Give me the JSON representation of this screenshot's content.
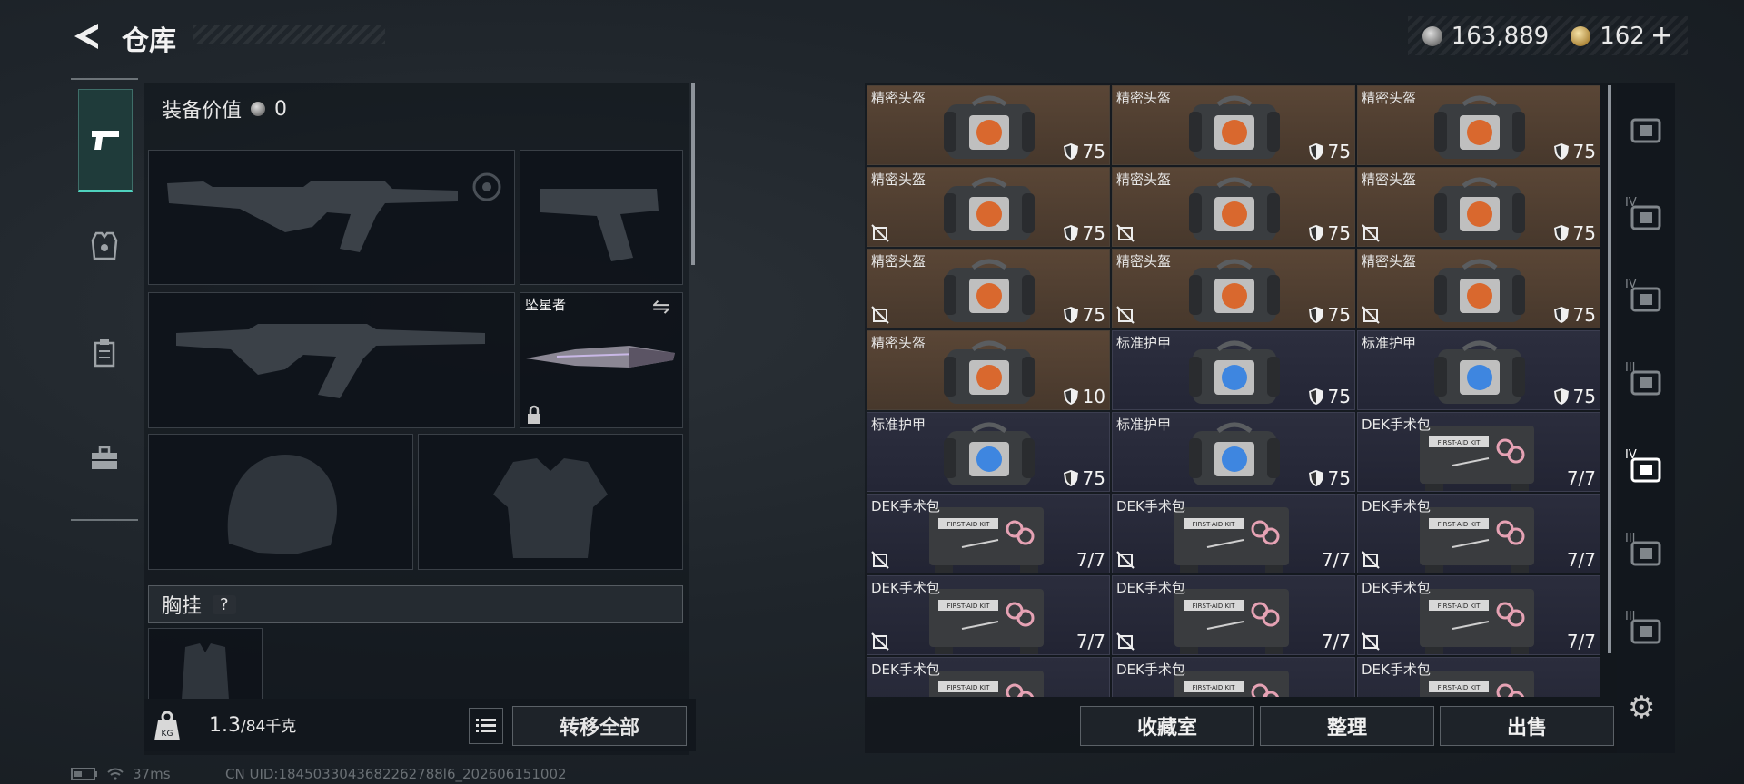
{
  "header": {
    "title": "仓库"
  },
  "currency": [
    {
      "amount": "163,889",
      "icon": "silver-coin-icon"
    },
    {
      "amount": "162",
      "icon": "gold-coin-icon",
      "plus": "+"
    }
  ],
  "loadout": {
    "equip_value_label": "装备价值",
    "equip_value": "0",
    "melee_name": "坠星者",
    "chest_label": "胸挂",
    "chest_help": "?"
  },
  "weight": {
    "current": "1.3",
    "max": "/84",
    "unit": "千克"
  },
  "buttons": {
    "transfer_all": "转移全部",
    "collection": "收藏室",
    "organize": "整理",
    "sell": "出售"
  },
  "status": {
    "ping": "37ms",
    "uid": "CN UID:1845033043682262788l6_202606151002"
  },
  "inventory": [
    {
      "name": "精密头盔",
      "type": "helm",
      "value": "75",
      "noins": false
    },
    {
      "name": "精密头盔",
      "type": "helm",
      "value": "75",
      "noins": false
    },
    {
      "name": "精密头盔",
      "type": "helm",
      "value": "75",
      "noins": false
    },
    {
      "name": "精密头盔",
      "type": "helm",
      "value": "75",
      "noins": true
    },
    {
      "name": "精密头盔",
      "type": "helm",
      "value": "75",
      "noins": true
    },
    {
      "name": "精密头盔",
      "type": "helm",
      "value": "75",
      "noins": true
    },
    {
      "name": "精密头盔",
      "type": "helm",
      "value": "75",
      "noins": true
    },
    {
      "name": "精密头盔",
      "type": "helm",
      "value": "75",
      "noins": true
    },
    {
      "name": "精密头盔",
      "type": "helm",
      "value": "75",
      "noins": true
    },
    {
      "name": "精密头盔",
      "type": "helm",
      "value": "10",
      "noins": false
    },
    {
      "name": "标准护甲",
      "type": "armor",
      "value": "75",
      "noins": false
    },
    {
      "name": "标准护甲",
      "type": "armor",
      "value": "75",
      "noins": false
    },
    {
      "name": "标准护甲",
      "type": "armor",
      "value": "75",
      "noins": false
    },
    {
      "name": "标准护甲",
      "type": "armor",
      "value": "75",
      "noins": false
    },
    {
      "name": "DEK手术包",
      "type": "med",
      "value": "7/7",
      "noins": false
    },
    {
      "name": "DEK手术包",
      "type": "med",
      "value": "7/7",
      "noins": true
    },
    {
      "name": "DEK手术包",
      "type": "med",
      "value": "7/7",
      "noins": true
    },
    {
      "name": "DEK手术包",
      "type": "med",
      "value": "7/7",
      "noins": true
    },
    {
      "name": "DEK手术包",
      "type": "med",
      "value": "7/7",
      "noins": true
    },
    {
      "name": "DEK手术包",
      "type": "med",
      "value": "7/7",
      "noins": true
    },
    {
      "name": "DEK手术包",
      "type": "med",
      "value": "7/7",
      "noins": true
    },
    {
      "name": "DEK手术包",
      "type": "med",
      "value": "",
      "noins": false
    },
    {
      "name": "DEK手术包",
      "type": "med",
      "value": "",
      "noins": false
    },
    {
      "name": "DEK手术包",
      "type": "med",
      "value": "",
      "noins": false
    }
  ],
  "categories": [
    {
      "icon": "helmet-category-icon",
      "tier": ""
    },
    {
      "icon": "armor-tier4-icon",
      "tier": "IV"
    },
    {
      "icon": "chest-rig-tier4-icon",
      "tier": "IV"
    },
    {
      "icon": "backpack-tier3-icon",
      "tier": "III"
    },
    {
      "icon": "medkit-tier4-icon",
      "tier": "IV"
    },
    {
      "icon": "gear-tier3-icon",
      "tier": "III"
    },
    {
      "icon": "ammo-tier3-icon",
      "tier": "III"
    }
  ],
  "medkit_label": "FIRST-AID KIT"
}
